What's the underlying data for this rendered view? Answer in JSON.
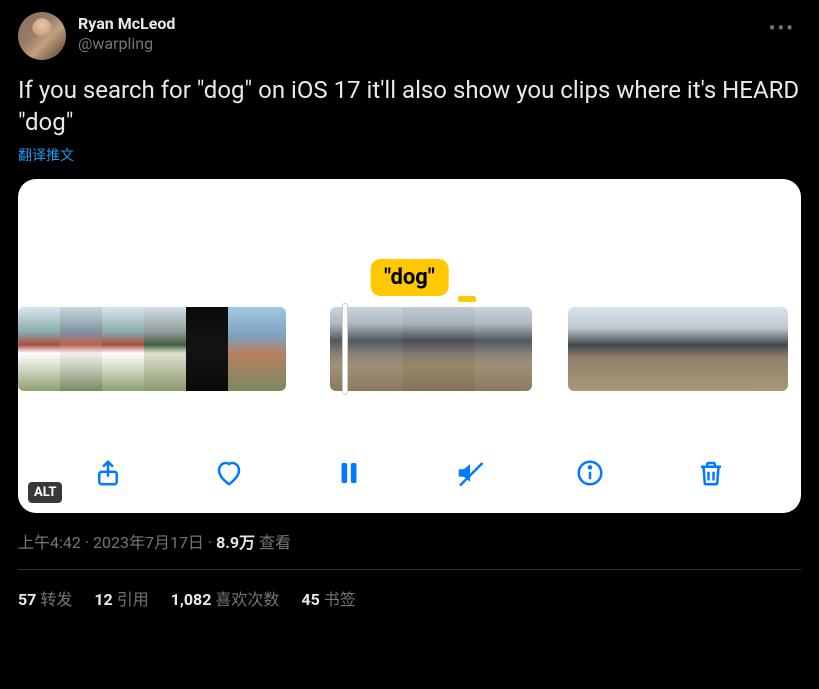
{
  "author": {
    "display_name": "Ryan McLeod",
    "handle": "@warpling"
  },
  "tweet_text": "If you search for \"dog\" on iOS 17 it'll also show you clips where it's HEARD \"dog\"",
  "translate_label": "翻译推文",
  "media": {
    "tooltip_text": "\"dog\"",
    "alt_badge": "ALT"
  },
  "meta": {
    "time": "上午4:42",
    "sep1": " · ",
    "date": "2023年7月17日",
    "sep2": " · ",
    "views_num": "8.9万",
    "views_label": " 查看"
  },
  "stats": {
    "retweets_num": "57",
    "retweets_label": "转发",
    "quotes_num": "12",
    "quotes_label": "引用",
    "likes_num": "1,082",
    "likes_label": "喜欢次数",
    "bookmarks_num": "45",
    "bookmarks_label": "书签"
  }
}
